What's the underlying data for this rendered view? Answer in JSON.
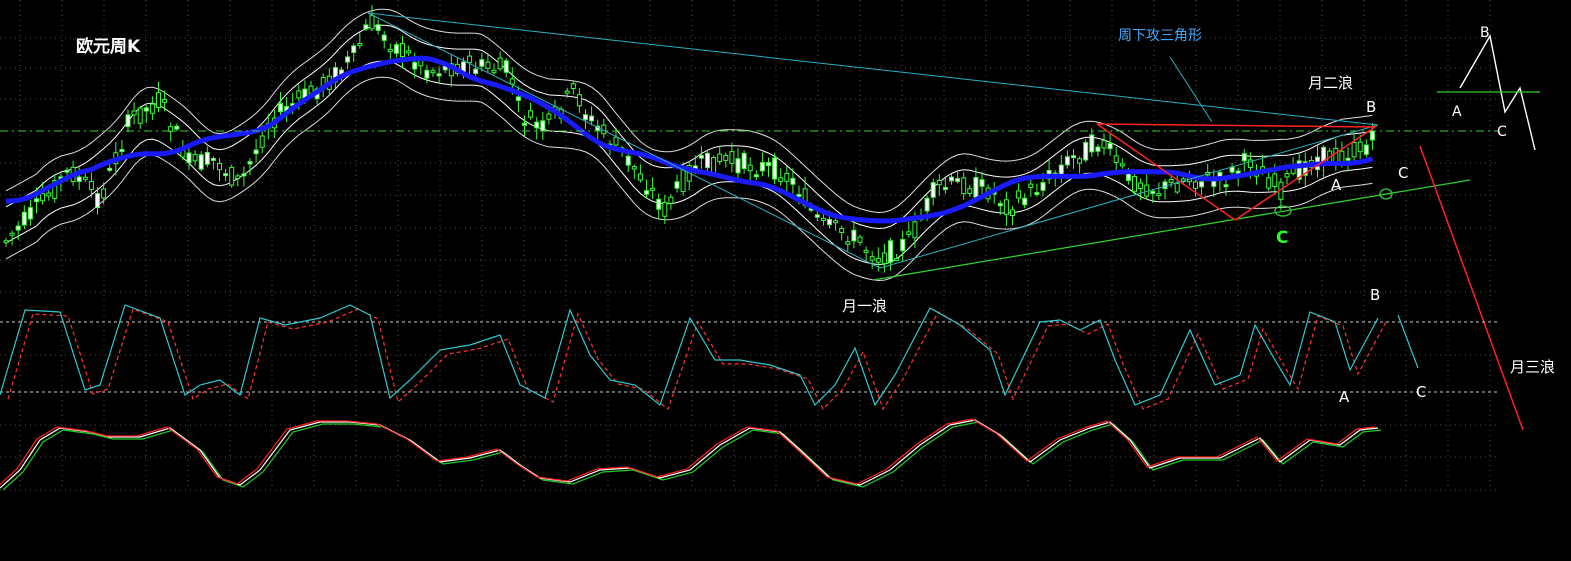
{
  "chart_data": {
    "type": "candlestick",
    "title": "欧元周K",
    "panels": {
      "price": {
        "series": [
          "candles",
          "moving-average",
          "upper-envelope",
          "lower-envelope",
          "outer-upper-envelope",
          "outer-lower-envelope"
        ]
      },
      "oscillator_1": {
        "series": [
          "fast-line",
          "slow-line"
        ]
      },
      "oscillator_2": {
        "series": [
          "white-line",
          "red-line",
          "green-line"
        ]
      }
    },
    "annotations": {
      "triangle_label": "周下攻三角形",
      "wave1_label": "月一浪",
      "wave2_label": "月二浪",
      "wave3_label": "月三浪",
      "point_A": "A",
      "point_B": "B",
      "point_C": "C"
    },
    "colors": {
      "background": "#000000",
      "up_candle": "#33ff33",
      "ma": "#1a1aff",
      "envelope": "#ffffff",
      "trend_teal": "#2ab0c0",
      "trend_green": "#33cc33",
      "trend_red": "#ff2020",
      "triangle_label": "#3fa9ff",
      "green_c": "#22ff22",
      "osc_fast": "#30c8d0",
      "osc_slow": "#ff3030",
      "grid": "#5a5a5a"
    }
  }
}
